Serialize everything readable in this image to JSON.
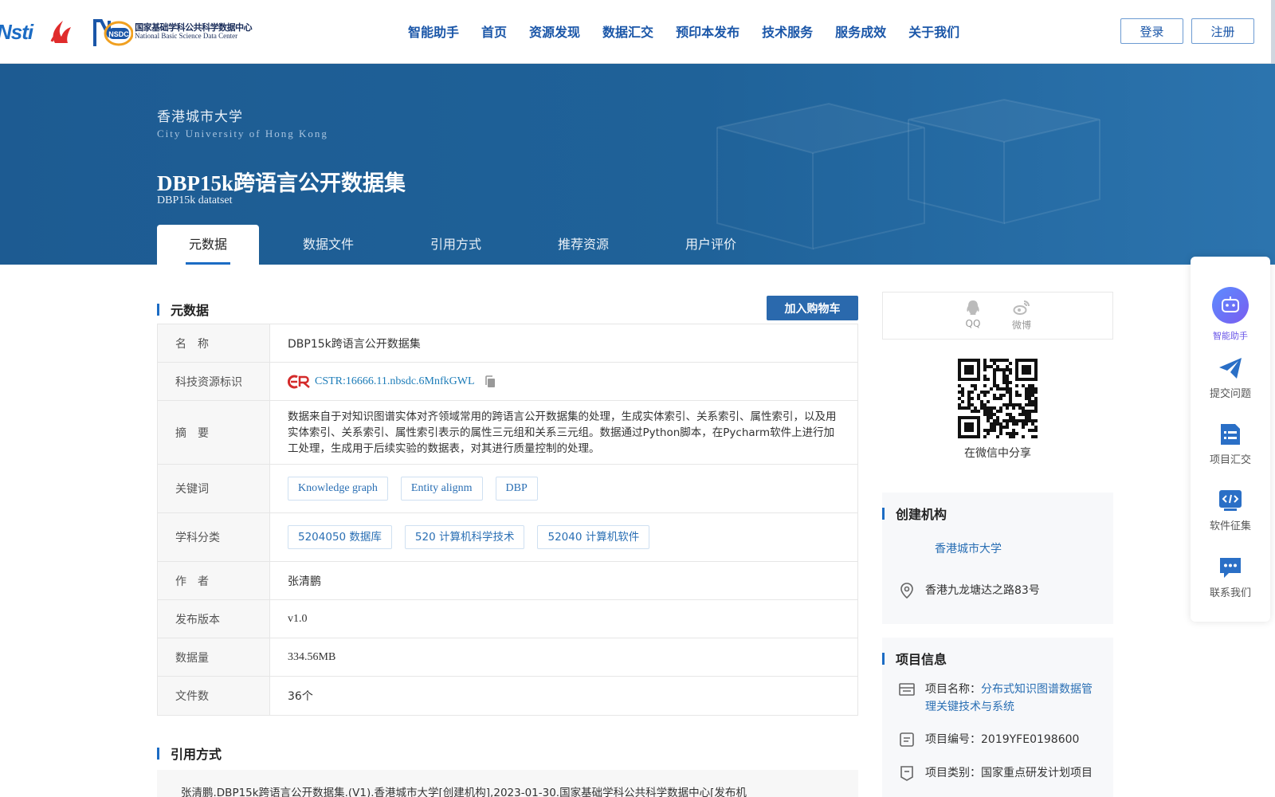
{
  "header": {
    "logos": {
      "nsti": "Nsti",
      "nsdc_badge": "NSDC",
      "nsdc_cn": "国家基础学科公共科学数据中心",
      "nsdc_en": "National Basic Science Data Center"
    },
    "nav": [
      "智能助手",
      "首页",
      "资源发现",
      "数据汇交",
      "预印本发布",
      "技术服务",
      "服务成效",
      "关于我们"
    ],
    "login": "登录",
    "register": "注册"
  },
  "banner": {
    "org_cn": "香港城市大学",
    "org_en": "City University of Hong Kong",
    "title": "DBP15k跨语言公开数据集",
    "subtitle": "DBP15k datatset",
    "tabs": [
      "元数据",
      "数据文件",
      "引用方式",
      "推荐资源",
      "用户评价"
    ],
    "active_tab": 0
  },
  "metadata": {
    "section_title": "元数据",
    "cart_button": "加入购物车",
    "labels": {
      "name": "名　称",
      "cstr": "科技资源标识",
      "abstract": "摘　要",
      "keywords": "关键词",
      "subjects": "学科分类",
      "author": "作　者",
      "version": "发布版本",
      "size": "数据量",
      "files": "文件数"
    },
    "values": {
      "name": "DBP15k跨语言公开数据集",
      "cstr": "CSTR:16666.11.nbsdc.6MnfkGWL",
      "abstract": "数据来自于对知识图谱实体对齐领域常用的跨语言公开数据集的处理，生成实体索引、关系索引、属性索引，以及用实体索引、关系索引、属性索引表示的属性三元组和关系三元组。数据通过Python脚本，在Pycharm软件上进行加工处理，生成用于后续实验的数据表，对其进行质量控制的处理。",
      "keywords": [
        "Knowledge graph",
        "Entity alignm",
        "DBP"
      ],
      "subjects": [
        "5204050 数据库",
        "520 计算机科学技术",
        "52040 计算机软件"
      ],
      "author": "张清鹏",
      "version": "v1.0",
      "size": "334.56MB",
      "files": "36个"
    }
  },
  "citation": {
    "section_title": "引用方式",
    "text": "张清鹏.DBP15k跨语言公开数据集.(V1).香港城市大学[创建机构],2023-01-30.国家基础学科公共科学数据中心[发布机"
  },
  "share": {
    "qq": "QQ",
    "weibo": "微博",
    "wechat": "在微信中分享"
  },
  "creator": {
    "title": "创建机构",
    "org": "香港城市大学",
    "address": "香港九龙塘达之路83号"
  },
  "project": {
    "title": "项目信息",
    "name_label": "项目名称：",
    "name_line1": "分布式知识图谱数据管",
    "name_line2": "理关键技术与系统",
    "number": "项目编号：2019YFE0198600",
    "category": "项目类别：国家重点研发计划项目"
  },
  "float_panel": [
    "智能助手",
    "提交问题",
    "项目汇交",
    "软件征集",
    "联系我们"
  ],
  "colors": {
    "primary": "#1c6cc4",
    "banner": "#1f6299",
    "nav": "#1a56a8",
    "accent_ai": "#6a56e8",
    "cstr_red": "#d42b2b"
  }
}
